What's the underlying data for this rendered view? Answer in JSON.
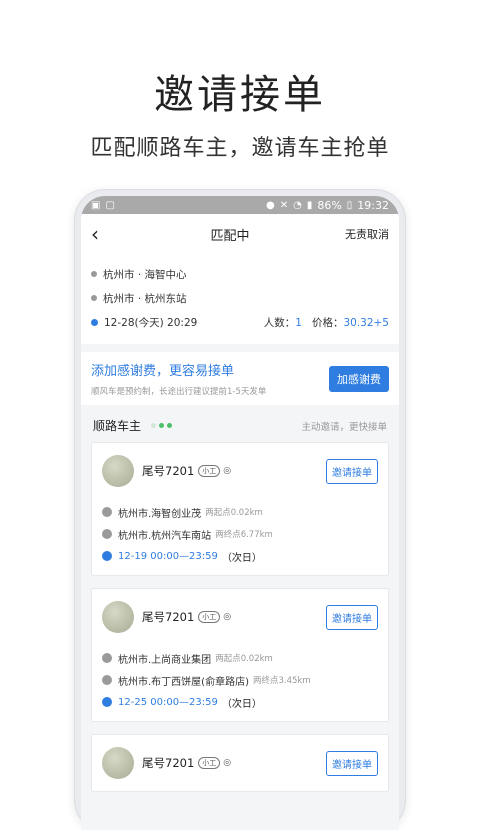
{
  "promo": {
    "headline": "邀请接单",
    "subline": "匹配顺路车主，邀请车主抢单"
  },
  "statusbar": {
    "battery": "86%",
    "time": "19:32"
  },
  "nav": {
    "back": "‹",
    "title": "匹配中",
    "cancel": "无责取消"
  },
  "route": {
    "start": "杭州市 · 海智中心",
    "end": "杭州市 · 杭州东站",
    "time": "12-28(今天) 20:29",
    "people_label": "人数：",
    "people_value": "1",
    "price_label": "价格：",
    "price_value": "30.32+5"
  },
  "thanks": {
    "title": "添加感谢费，更容易接单",
    "subtitle": "顺风车是预约制，长途出行建议提前1-5天发单",
    "button": "加感谢费"
  },
  "list": {
    "title": "顺路车主",
    "hint": "主动邀请，更快接单"
  },
  "drivers": [
    {
      "name": "尾号7201",
      "tag": "小工",
      "button": "邀请接单",
      "start": "杭州市.海智创业茂",
      "start_dist": "两起点0.02km",
      "end": "杭州市.杭州汽车南站",
      "end_dist": "两终点6.77km",
      "time": "12-19 00:00—23:59",
      "time_suffix": "（次日）"
    },
    {
      "name": "尾号7201",
      "tag": "小工",
      "button": "邀请接单",
      "start": "杭州市.上尚商业集团",
      "start_dist": "两起点0.02km",
      "end": "杭州市.布丁西饼屋(俞章路店)",
      "end_dist": "两终点3.45km",
      "time": "12-25 00:00—23:59",
      "time_suffix": "（次日）"
    },
    {
      "name": "尾号7201",
      "tag": "小工",
      "button": "邀请接单"
    }
  ],
  "colors": {
    "accent": "#2f7de1",
    "green": "#4cbf6a"
  }
}
